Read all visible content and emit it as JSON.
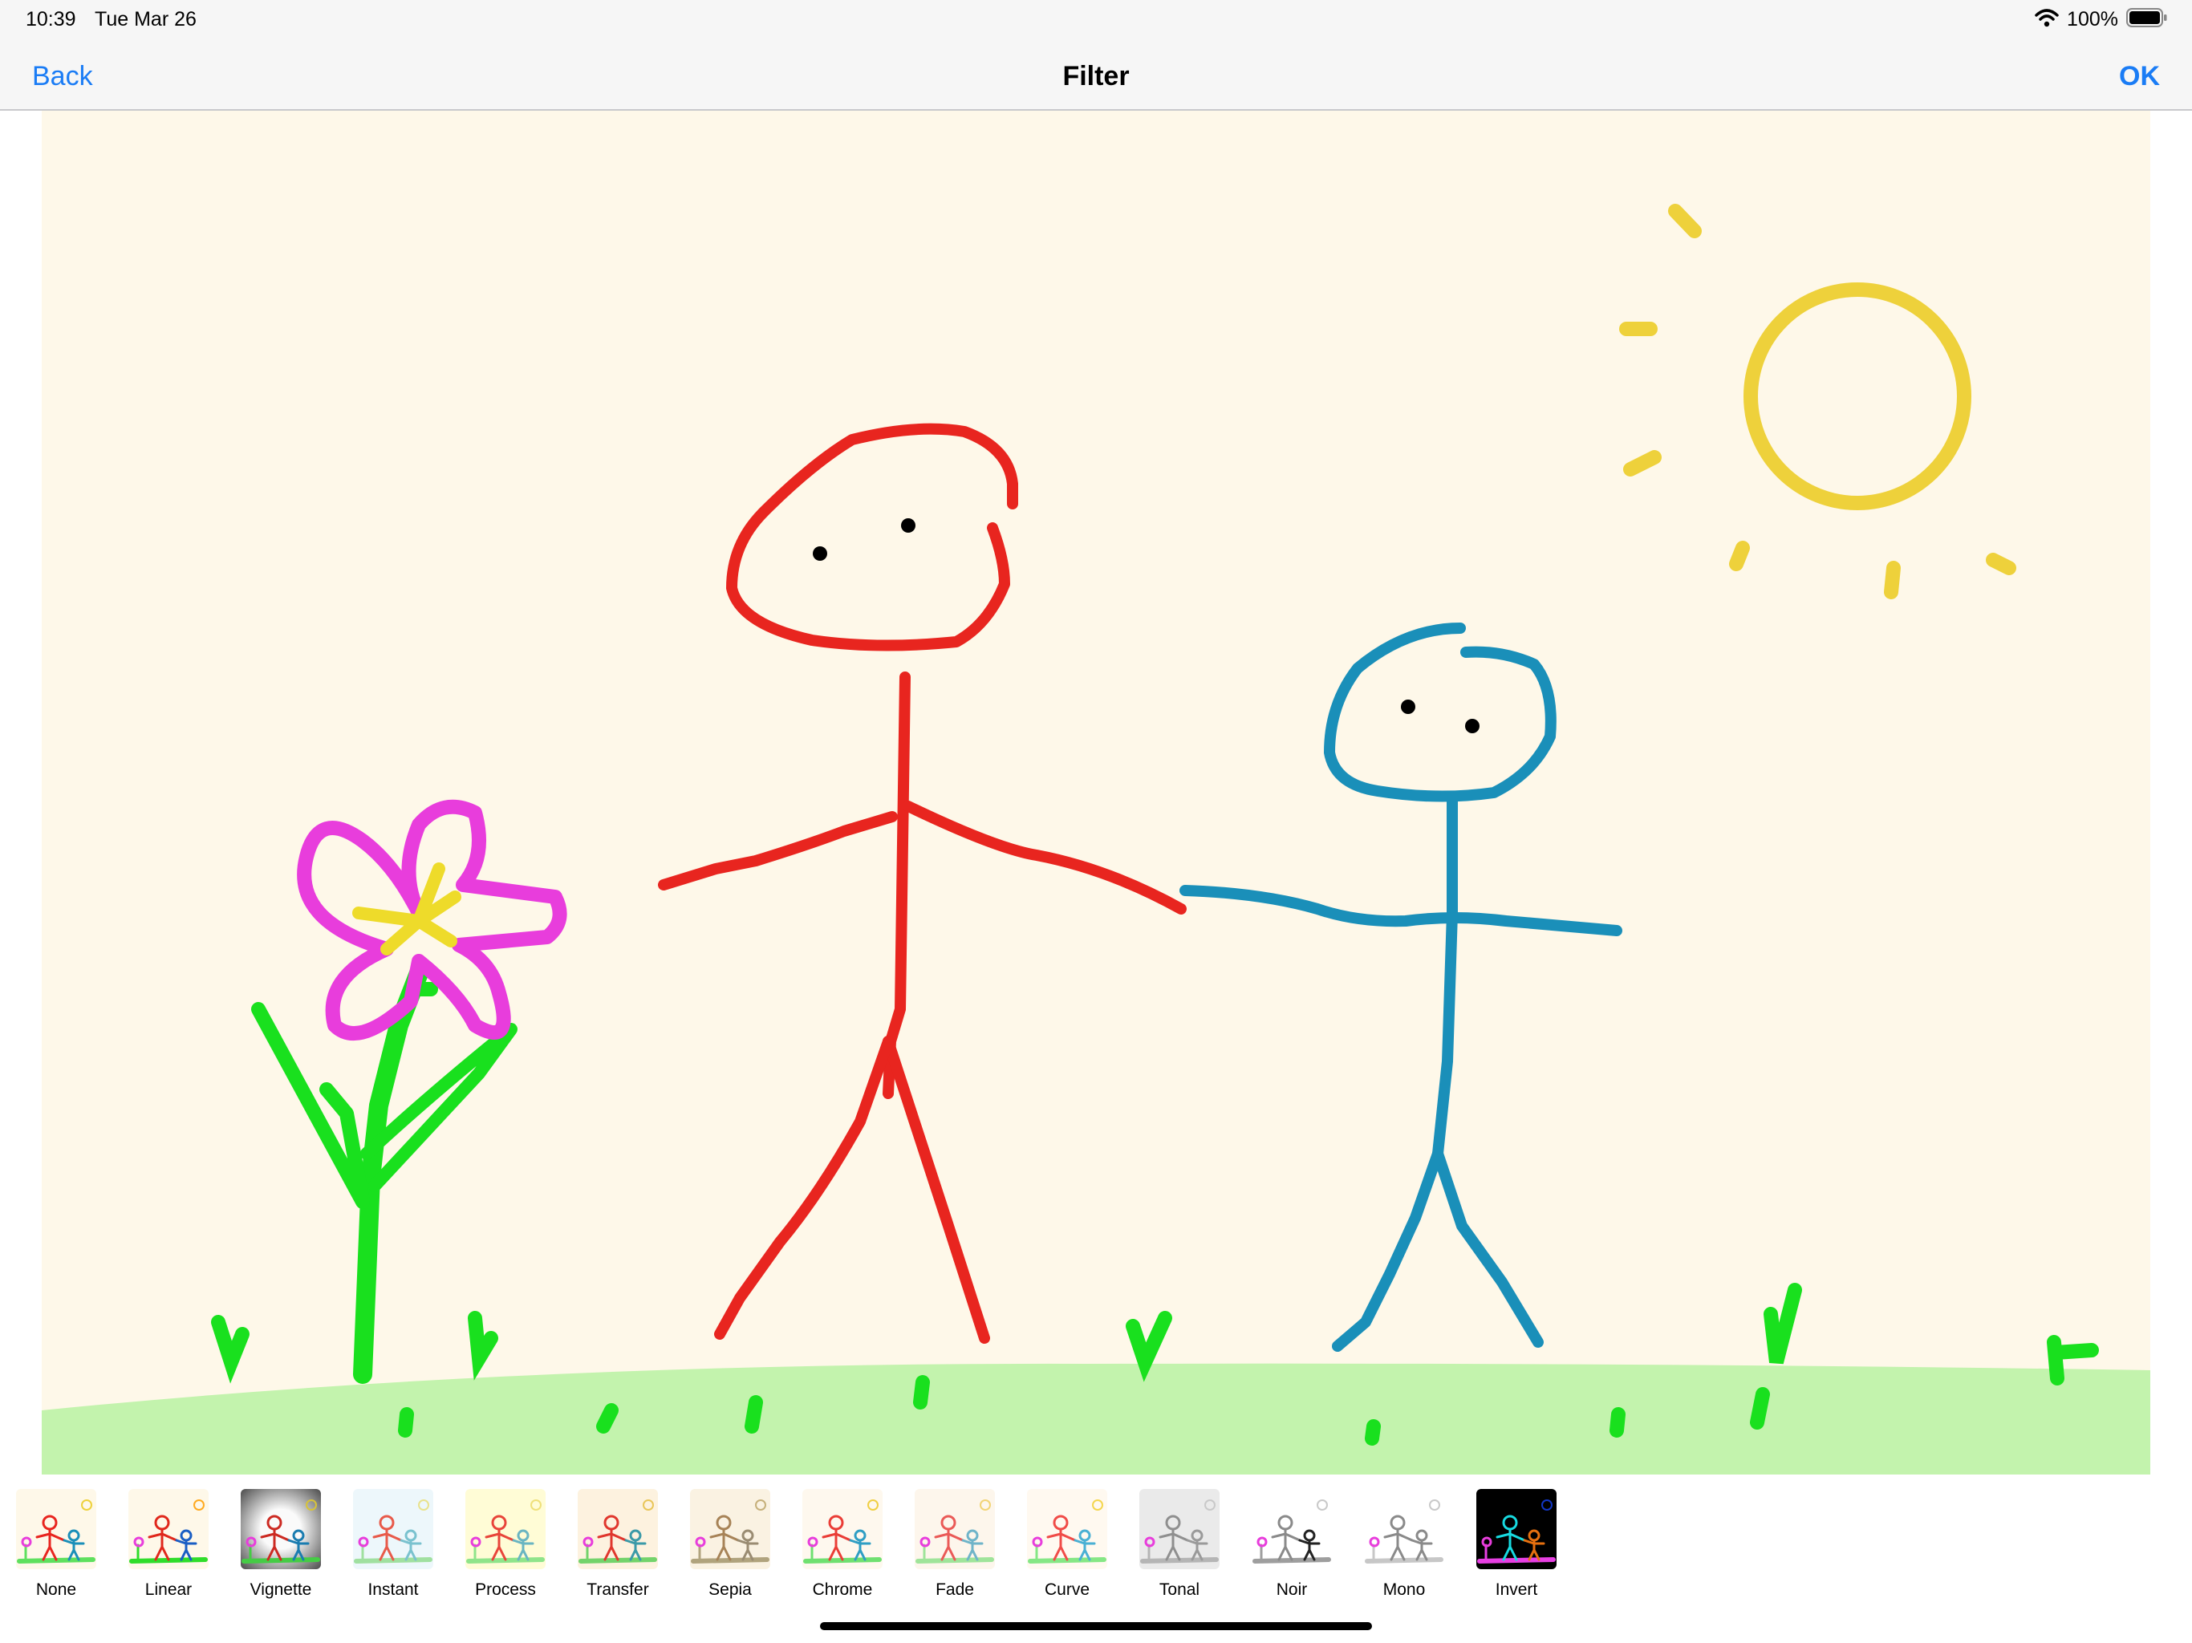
{
  "status": {
    "time": "10:39",
    "date": "Tue Mar 26",
    "battery": "100%",
    "wifi_icon": "wifi-icon",
    "battery_icon": "battery-full-icon"
  },
  "nav": {
    "back": "Back",
    "title": "Filter",
    "ok": "OK",
    "accent": "#1a7cf5"
  },
  "canvas": {
    "background": "#fef8e9",
    "grass_color": "#c3f3ad",
    "drawing": "child drawing of a flower, two stick figures holding hands, and a sun"
  },
  "filters": [
    {
      "label": "None"
    },
    {
      "label": "Linear"
    },
    {
      "label": "Vignette"
    },
    {
      "label": "Instant"
    },
    {
      "label": "Process"
    },
    {
      "label": "Transfer"
    },
    {
      "label": "Sepia"
    },
    {
      "label": "Chrome"
    },
    {
      "label": "Fade"
    },
    {
      "label": "Curve"
    },
    {
      "label": "Tonal"
    },
    {
      "label": "Noir"
    },
    {
      "label": "Mono"
    },
    {
      "label": "Invert"
    }
  ]
}
